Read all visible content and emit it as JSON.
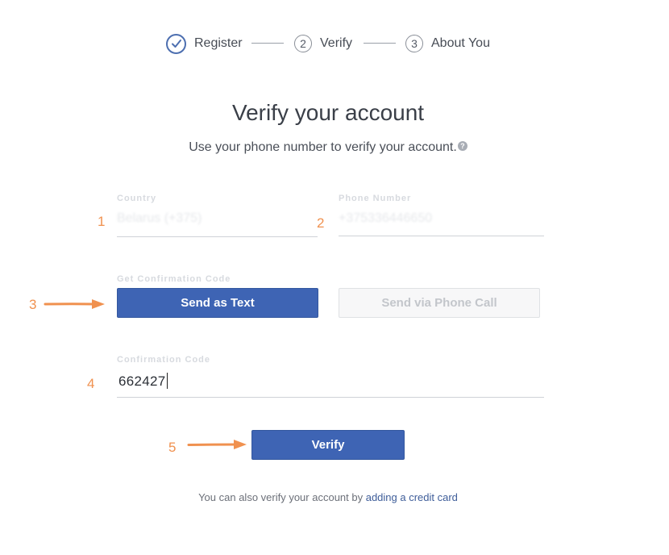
{
  "stepper": {
    "steps": [
      {
        "number": "",
        "label": "Register",
        "status": "complete",
        "icon": "check-icon"
      },
      {
        "number": "2",
        "label": "Verify",
        "status": "current"
      },
      {
        "number": "3",
        "label": "About You",
        "status": "upcoming"
      }
    ]
  },
  "header": {
    "title": "Verify your account",
    "subtitle": "Use your phone number to verify your account.",
    "help_icon": "question-circle-icon"
  },
  "form": {
    "country": {
      "label": "Country",
      "value": "Belarus (+375)"
    },
    "phone": {
      "label": "Phone Number",
      "value": "+375336446650"
    },
    "confirmation_method_label": "Get Confirmation Code",
    "send_text_button": "Send as Text",
    "send_call_button": "Send via Phone Call",
    "confirmation_code": {
      "label": "Confirmation Code",
      "value": "662427"
    },
    "verify_button": "Verify"
  },
  "footer": {
    "text": "You can also verify your account by ",
    "link": "adding a credit card"
  },
  "annotations": {
    "labels": [
      "1",
      "2",
      "3",
      "4",
      "5"
    ],
    "color": "#f0914f"
  },
  "colors": {
    "primary": "#3e64b4",
    "link": "#3e5d99",
    "annotation": "#f0914f"
  }
}
